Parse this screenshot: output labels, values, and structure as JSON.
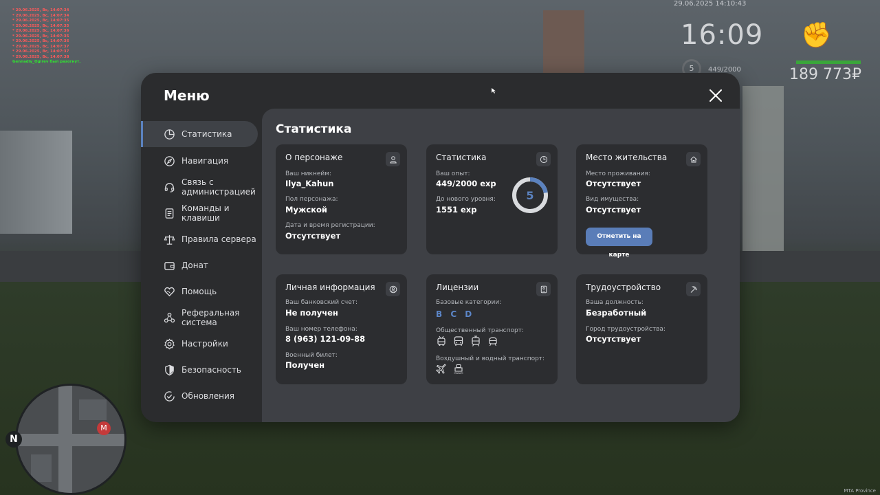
{
  "hud": {
    "chat_lines": [
      "* 29.06.2025, Вс, 14:07:34",
      "* 29.06.2025, Вс, 14:07:34",
      "* 29.06.2025, Вс, 14:07:35",
      "* 29.06.2025, Вс, 14:07:35",
      "* 29.06.2025, Вс, 14:07:36",
      "* 29.06.2025, Вс, 14:07:35",
      "* 29.06.2025, Вс, 14:07:36",
      "* 29.06.2025, Вс, 14:07:37",
      "* 29.06.2025, Вс, 14:07:37",
      "* 29.06.2025, Вс, 14:07:38"
    ],
    "chat_last": "Gennadiy_Ogirev был разогнут.",
    "date": "29.06.2025 14:10:43",
    "time": "16:09",
    "level": "5",
    "exp": "449/2000",
    "money": "189 773₽",
    "compass": "N",
    "watermark": "MTA Province"
  },
  "menu": {
    "title": "Меню",
    "nav": [
      {
        "label": "Статистика",
        "icon": "pie-chart-icon"
      },
      {
        "label": "Навигация",
        "icon": "compass-icon"
      },
      {
        "label": "Связь с администрацией",
        "icon": "headset-icon"
      },
      {
        "label": "Команды и клавиши",
        "icon": "document-icon"
      },
      {
        "label": "Правила сервера",
        "icon": "scales-icon"
      },
      {
        "label": "Донат",
        "icon": "wallet-icon"
      },
      {
        "label": "Помощь",
        "icon": "heart-hand-icon"
      },
      {
        "label": "Реферальная система",
        "icon": "network-icon"
      },
      {
        "label": "Настройки",
        "icon": "gear-icon"
      },
      {
        "label": "Безопасность",
        "icon": "shield-icon"
      },
      {
        "label": "Обновления",
        "icon": "check-circle-icon"
      }
    ],
    "active_index": 0
  },
  "stats": {
    "title": "Статистика",
    "character": {
      "title": "О персонаже",
      "nickname_label": "Ваш никнейм:",
      "nickname": "Ilya_Kahun",
      "gender_label": "Пол персонажа:",
      "gender": "Мужской",
      "reg_label": "Дата и время регистрации:",
      "reg": "Отсутствует"
    },
    "statistics": {
      "title": "Статистика",
      "exp_label": "Ваш опыт:",
      "exp": "449/2000 exp",
      "next_label": "До нового уровня:",
      "next": "1551 exp",
      "level": "5",
      "progress": 0.2245
    },
    "residence": {
      "title": "Место жительства",
      "place_label": "Место проживания:",
      "place": "Отсутствует",
      "property_label": "Вид имущества:",
      "property": "Отсутствует",
      "button": "Отметить на карте"
    },
    "personal": {
      "title": "Личная информация",
      "bank_label": "Ваш банковский счет:",
      "bank": "Не получен",
      "phone_label": "Ваш номер телефона:",
      "phone": "8 (963) 121-09-88",
      "military_label": "Военный билет:",
      "military": "Получен"
    },
    "licenses": {
      "title": "Лицензии",
      "base_label": "Базовые категории:",
      "base": "B C D",
      "public_label": "Общественный транспорт:",
      "air_label": "Воздушный и водный транспорт:"
    },
    "employment": {
      "title": "Трудоустройство",
      "position_label": "Ваша должность:",
      "position": "Безработный",
      "city_label": "Город трудоустройства:",
      "city": "Отсутствует"
    }
  },
  "colors": {
    "accent": "#5b82bf",
    "window": "#2b2c2e",
    "panel": "#3e4045",
    "card": "#2c2d30"
  }
}
